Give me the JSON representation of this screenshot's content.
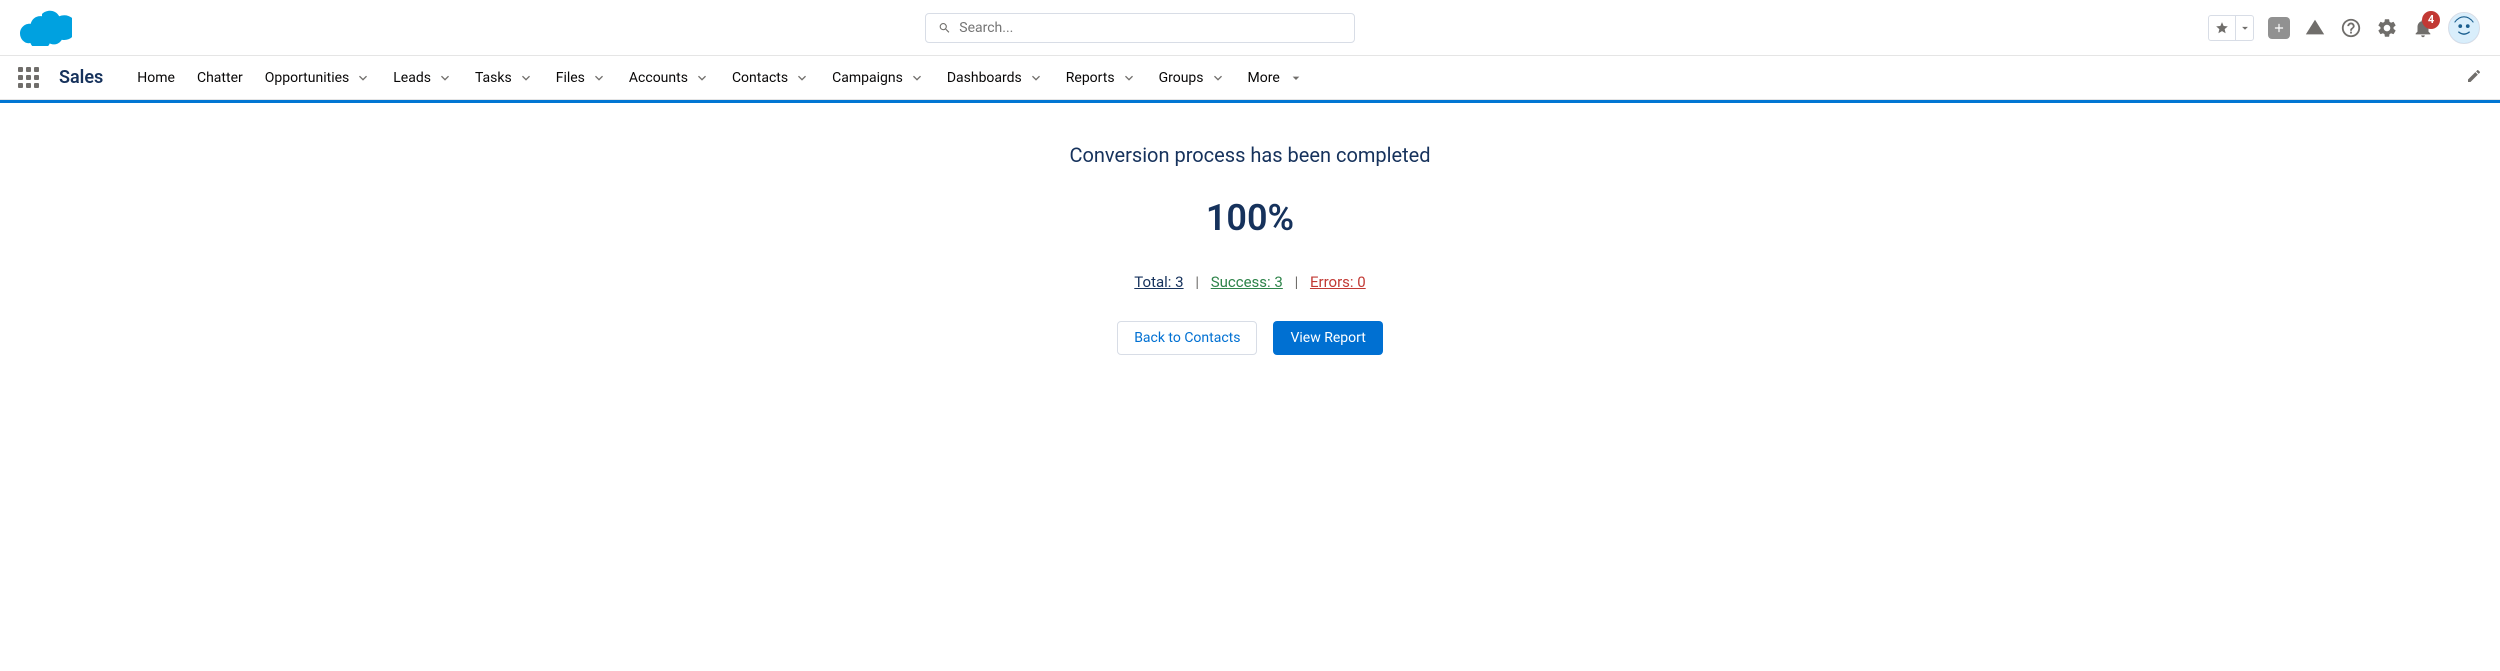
{
  "header": {
    "search_placeholder": "Search...",
    "notification_count": "4"
  },
  "nav": {
    "app_name": "Sales",
    "items": [
      {
        "label": "Home",
        "dropdown": false
      },
      {
        "label": "Chatter",
        "dropdown": false
      },
      {
        "label": "Opportunities",
        "dropdown": true
      },
      {
        "label": "Leads",
        "dropdown": true
      },
      {
        "label": "Tasks",
        "dropdown": true
      },
      {
        "label": "Files",
        "dropdown": true
      },
      {
        "label": "Accounts",
        "dropdown": true
      },
      {
        "label": "Contacts",
        "dropdown": true
      },
      {
        "label": "Campaigns",
        "dropdown": true
      },
      {
        "label": "Dashboards",
        "dropdown": true
      },
      {
        "label": "Reports",
        "dropdown": true
      },
      {
        "label": "Groups",
        "dropdown": true
      }
    ],
    "more_label": "More"
  },
  "content": {
    "title": "Conversion process has been completed",
    "percent": "100%",
    "total_label": "Total: 3",
    "success_label": "Success: 3",
    "errors_label": "Errors: 0",
    "separator": "|",
    "back_button": "Back to Contacts",
    "view_report_button": "View Report"
  }
}
